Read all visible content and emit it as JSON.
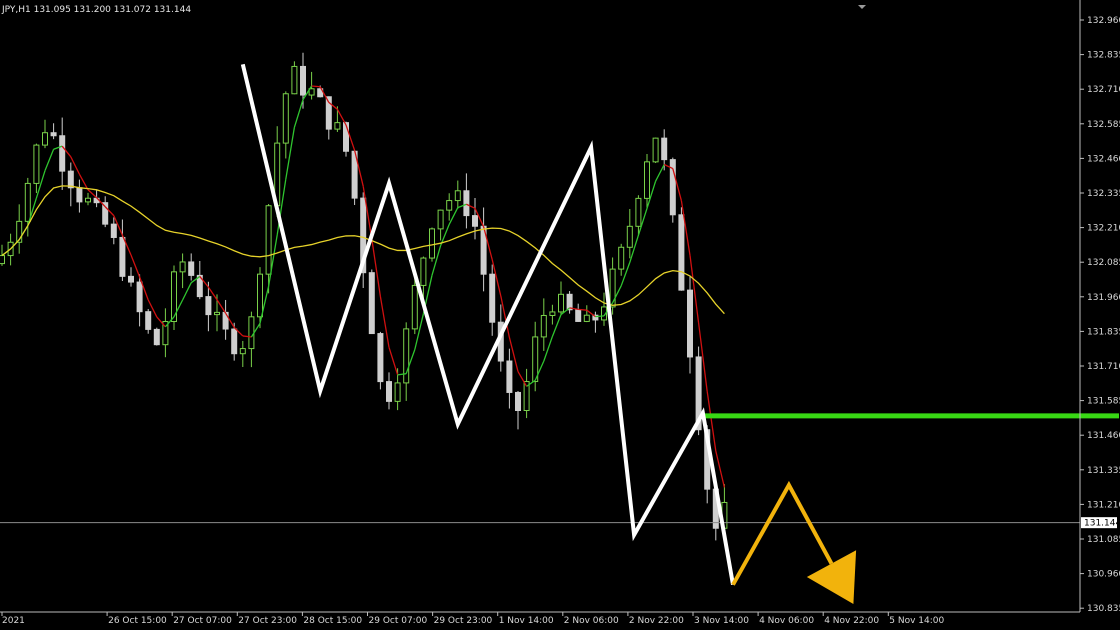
{
  "header": {
    "symbol_info": "JPY,H1  131.095 131.200 131.072 131.144"
  },
  "chart_data": {
    "type": "candlestick",
    "y_axis": {
      "labels": [
        "132.960",
        "132.835",
        "132.710",
        "132.585",
        "132.460",
        "132.335",
        "132.210",
        "132.085",
        "131.960",
        "131.835",
        "131.710",
        "131.585",
        "131.460",
        "131.335",
        "131.210",
        "131.085",
        "130.960",
        "130.835"
      ],
      "ylim": [
        130.78,
        133.04
      ]
    },
    "x_axis": {
      "labels": [
        "2021",
        "26 Oct 15:00",
        "27 Oct 07:00",
        "27 Oct 23:00",
        "28 Oct 15:00",
        "29 Oct 07:00",
        "29 Oct 23:00",
        "1 Nov 14:00",
        "2 Nov 06:00",
        "2 Nov 22:00",
        "3 Nov 14:00",
        "4 Nov 06:00",
        "4 Nov 22:00",
        "5 Nov 14:00"
      ]
    },
    "current_price": 131.144,
    "current_price_label": "131.144",
    "resistance_level": 131.53,
    "price_path": [
      132.08,
      132.15,
      132.25,
      132.38,
      132.52,
      132.6,
      132.48,
      132.4,
      132.33,
      132.3,
      132.25,
      132.2,
      132.1,
      132.0,
      131.9,
      131.82,
      131.78,
      131.95,
      132.1,
      132.05,
      131.98,
      131.9,
      131.85,
      131.8,
      131.78,
      131.85,
      132.1,
      132.35,
      132.62,
      132.78,
      132.72,
      132.7,
      132.65,
      132.58,
      132.55,
      132.4,
      132.1,
      131.85,
      131.6,
      131.62,
      131.75,
      131.95,
      132.1,
      132.25,
      132.3,
      132.32,
      132.3,
      132.25,
      132.05,
      131.85,
      131.65,
      131.52,
      131.6,
      131.78,
      131.9,
      131.95,
      131.92,
      131.88,
      131.85,
      131.88,
      131.95,
      132.05,
      132.15,
      132.3,
      132.45,
      132.55,
      132.42,
      132.15,
      131.9,
      131.6,
      131.3,
      131.12,
      131.2,
      131.35,
      131.4,
      131.38,
      131.3,
      131.4,
      131.48,
      131.4,
      131.25,
      131.05,
      130.92,
      130.98,
      131.1,
      131.15
    ]
  },
  "overlays": {
    "zigzag": [
      {
        "t": 28.0,
        "p": 132.8
      },
      {
        "t": 37.0,
        "p": 131.62
      },
      {
        "t": 45.0,
        "p": 132.37
      },
      {
        "t": 53.0,
        "p": 131.5
      },
      {
        "t": 68.5,
        "p": 132.5
      },
      {
        "t": 73.5,
        "p": 131.1
      },
      {
        "t": 81.5,
        "p": 131.54
      },
      {
        "t": 85.0,
        "p": 130.92
      }
    ],
    "forecast": [
      {
        "t": 85.0,
        "p": 130.92
      },
      {
        "t": 91.5,
        "p": 131.28
      },
      {
        "t": 99.0,
        "p": 130.85
      }
    ],
    "colors": {
      "bull": "#7ad14a",
      "bear": "#cfcfcf",
      "ma_fast_up": "#2fc52f",
      "ma_fast_down": "#d01010",
      "ma_slow": "#e6d22a",
      "zigzag": "#ffffff",
      "forecast": "#f2b30c",
      "resistance": "#38d814"
    }
  }
}
